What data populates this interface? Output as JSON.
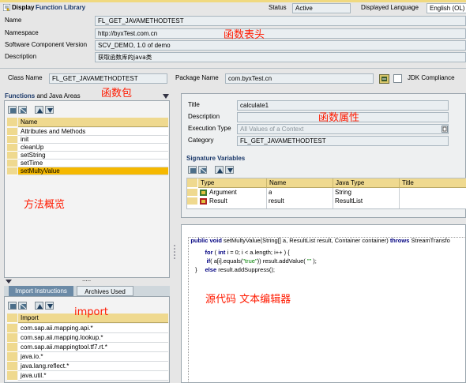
{
  "header": {
    "display_label": "Display",
    "library_label": "Function Library",
    "status_label": "Status",
    "status_value": "Active",
    "displayed_language_label": "Displayed Language",
    "displayed_language_value": "English (OL)"
  },
  "form": {
    "name_label": "Name",
    "name_value": "FL_GET_JAVAMETHODTEST",
    "namespace_label": "Namespace",
    "namespace_value": "http://byxTest.com.cn",
    "swc_label": "Software Component Version",
    "swc_value": "SCV_DEMO, 1.0 of demo",
    "description_label": "Description",
    "description_value": "获取函数库的java类"
  },
  "classbar": {
    "class_name_label": "Class Name",
    "class_name_value": "FL_GET_JAVAMETHODTEST",
    "package_label": "Package Name",
    "package_value": "com.byxTest.cn",
    "jdk_label": "JDK Compliance"
  },
  "annotations": {
    "header": "函数表头",
    "package": "函数包",
    "properties": "函数属性",
    "methods": "方法概览",
    "import": "import",
    "editor": "源代码 文本编辑器"
  },
  "functions_panel": {
    "title_bold": "Functions",
    "title_rest": "and Java Areas",
    "column_header": "Name",
    "items": [
      "Attributes and Methods",
      "init",
      "cleanUp",
      "setString",
      "setTime",
      "setMultyValue"
    ],
    "selected_index": 5
  },
  "properties": {
    "title_label": "Title",
    "title_value": "calculate1",
    "description_label": "Description",
    "description_value": "",
    "execution_type_label": "Execution Type",
    "execution_type_value": "All Values of a Context",
    "category_label": "Category",
    "category_value": "FL_GET_JAVAMETHODTEST"
  },
  "signature": {
    "title": "Signature Variables",
    "columns": [
      "Type",
      "Name",
      "Java Type",
      "Title"
    ],
    "rows": [
      {
        "type": "Argument",
        "name": "a",
        "java_type": "String",
        "title": ""
      },
      {
        "type": "Result",
        "name": "result",
        "java_type": "ResultList",
        "title": ""
      }
    ]
  },
  "code": {
    "signature_kw1": "public void",
    "signature_rest": " setMultyValue(String[] a, ResultList result, Container container) ",
    "signature_kw2": "throws",
    "signature_end": " StreamTransfo",
    "line1_kw": "for",
    "line1_a": " ( ",
    "line1_kw2": "int",
    "line1_b": " i = 0; i < a.length; i++ ) {",
    "line2_kw": "if",
    "line2_a": "( a[i].equals(",
    "line2_str": "\"true\"",
    "line2_b": ")) result.addValue( ",
    "line2_str2": "\"\"",
    "line2_c": " );",
    "line3_kw": "else",
    "line3_a": " result.addSuppress();",
    "line4": "}"
  },
  "bottom_panel": {
    "tab_import": "Import Instructions",
    "tab_archives": "Archives Used",
    "splitter_dots": ".....",
    "column_header": "Import",
    "items": [
      "com.sap.aii.mapping.api.*",
      "com.sap.aii.mapping.lookup.*",
      "com.sap.aii.mappingtool.tf7.rt.*",
      "java.io.*",
      "java.lang.reflect.*",
      "java.util.*"
    ]
  }
}
